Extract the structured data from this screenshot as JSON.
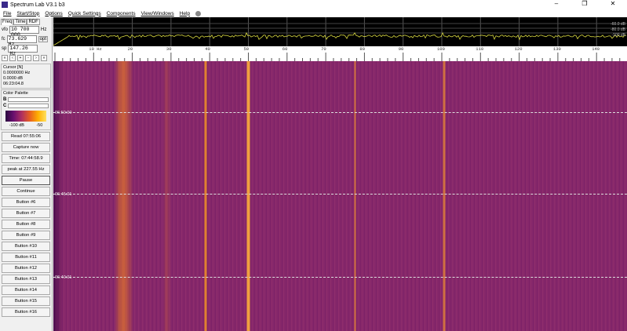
{
  "window": {
    "title": "Spectrum Lab V3.1 b3",
    "minimize": "–",
    "restore": "❐",
    "close": "✕"
  },
  "menu": [
    "File",
    "Start/Stop",
    "Options",
    "Quick Settings",
    "Components",
    "View/Windows",
    "Help"
  ],
  "tabs": [
    "Freq",
    "Time",
    "RDF"
  ],
  "freq": {
    "vfo_label": "vfo",
    "vfo": "10 700 000",
    "vfo_unit": "Hz",
    "fc_label": "fc",
    "fc": "73.629 Hz",
    "opt": "opt",
    "sp_label": "sp",
    "sp": "147.26 Hz",
    "arrows": [
      "«",
      "‹",
      "+",
      "-",
      "›",
      "»"
    ]
  },
  "cursor": {
    "title": "Cursor [N]",
    "freq": "0.0000000 Hz",
    "level": "0.0000 dB",
    "time": "06:23:04.8"
  },
  "palette": {
    "title": "Color Palette",
    "b": "B",
    "c": "C",
    "min": "-100 dB",
    "max": "-50"
  },
  "buttons": [
    "Read 07:55:06",
    "Capture now",
    "Time:  07:44:58.9",
    "peak at 227.55 Hz",
    "Pause",
    "Continue",
    "Button #6",
    "Button #7",
    "Button #8",
    "Button #9",
    "Button #10",
    "Button #11",
    "Button #12",
    "Button #13",
    "Button #14",
    "Button #15",
    "Button #16"
  ],
  "spectrum": {
    "db_labels": [
      "-60.0 dB",
      "-80.0 dB",
      "-100 dB"
    ],
    "trace_color": "#d8d840"
  },
  "freq_axis": [
    "10 Hz",
    "20",
    "30",
    "40",
    "50",
    "60",
    "70",
    "80",
    "90",
    "100",
    "110",
    "120",
    "130",
    "140"
  ],
  "time_marks": [
    "06:50:00",
    "06:45:01",
    "06:40:01"
  ]
}
